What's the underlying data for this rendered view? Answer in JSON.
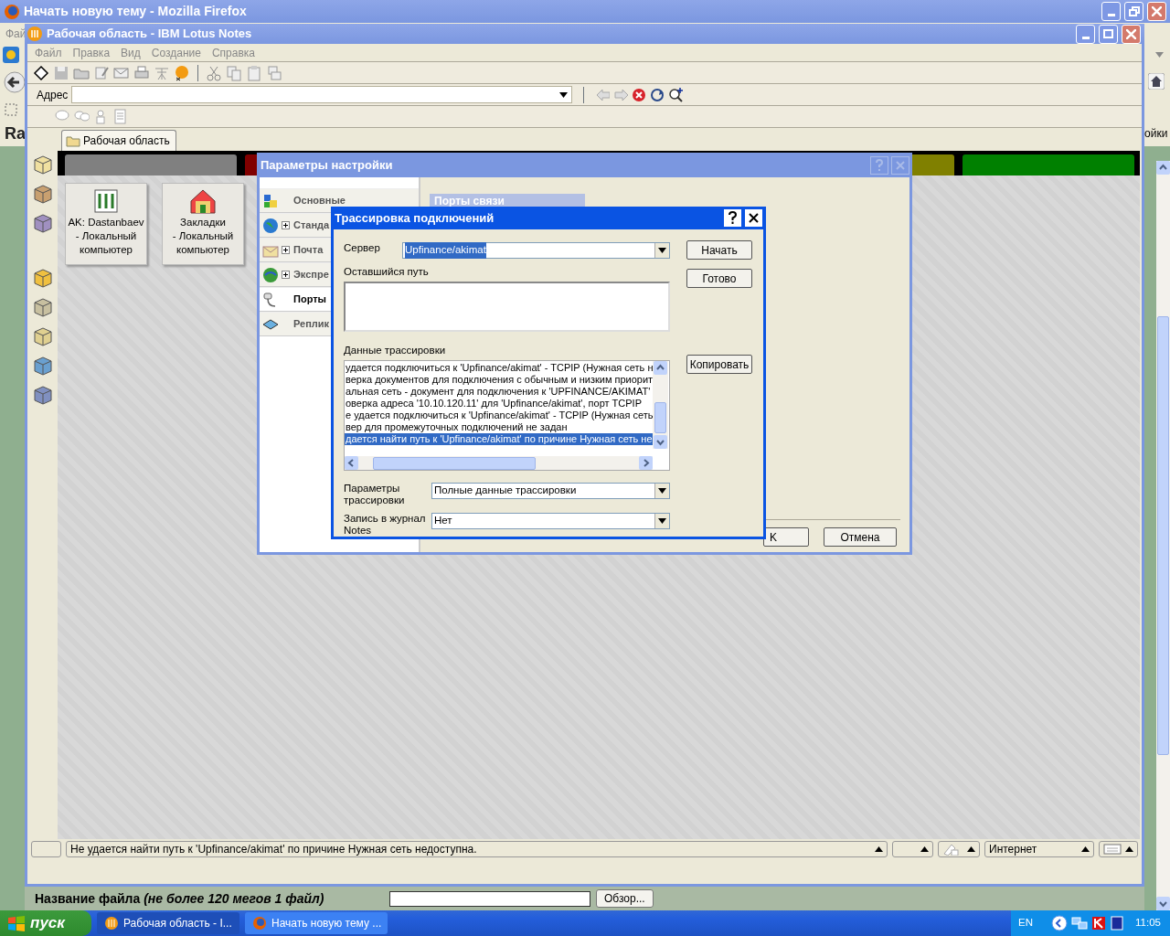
{
  "firefox": {
    "title": "Начать новую тему - Mozilla Firefox",
    "menu_fragment": "Фай",
    "page_fragment_left": "Ra",
    "page_fragment_right": "ойки",
    "file_label": "Название файла *(не более 120 мегов 1 файл)*",
    "browse_button": "Обзор..."
  },
  "notes": {
    "title": "Рабочая область - IBM Lotus Notes",
    "menu": [
      "Файл",
      "Правка",
      "Вид",
      "Создание",
      "Справка"
    ],
    "address_label": "Адрес",
    "tab_label": "Рабочая область",
    "workspace_tabs": [
      {
        "color": "#808080"
      },
      {
        "color": "#800000"
      },
      {
        "color": "#808000"
      },
      {
        "color": "#008000"
      }
    ],
    "tiles": [
      {
        "title": "AK: Dastanbaev",
        "subtitle": "- Локальный компьютер"
      },
      {
        "title": "Закладки",
        "subtitle": "- Локальный компьютер"
      }
    ],
    "status_message": "Не удается найти путь к 'Upfinance/akimat' по причине Нужная сеть недоступна.",
    "status_zone": "Интернет"
  },
  "settings_dialog": {
    "title": "Параметры настройки",
    "nav": [
      {
        "label": "Основные",
        "expandable": false,
        "selected": false
      },
      {
        "label": "Станда",
        "expandable": true,
        "selected": false
      },
      {
        "label": "Почта",
        "expandable": true,
        "selected": false
      },
      {
        "label": "Экспре",
        "expandable": true,
        "selected": false
      },
      {
        "label": "Порты",
        "expandable": false,
        "selected": true
      },
      {
        "label": "Реплик",
        "expandable": false,
        "selected": false
      }
    ],
    "section_title": "Порты связи",
    "ok_button": "K",
    "cancel_button": "Отмена"
  },
  "trace_dialog": {
    "title": "Трассировка подключений",
    "server_label": "Сервер",
    "server_value": "Upfinance/akimat",
    "remaining_path_label": "Оставшийся путь",
    "trace_label": "Данные трассировки",
    "trace_lines": [
      {
        "text": "удается подключиться к 'Upfinance/akimat' - TCPIP (Нужная сеть н",
        "selected": false
      },
      {
        "text": "верка документов для подключения с обычным и низким приорит",
        "selected": false
      },
      {
        "text": "альная сеть  - документ для подключения к 'UPFINANCE/AKIMAT'",
        "selected": false
      },
      {
        "text": "оверка адреса '10.10.120.11' для 'Upfinance/akimat', порт TCPIP",
        "selected": false
      },
      {
        "text": "е удается подключиться к 'Upfinance/akimat' - TCPIP (Нужная сеть",
        "selected": false
      },
      {
        "text": "вер для промежуточных подключений не задан",
        "selected": false
      },
      {
        "text": "дается найти путь к 'Upfinance/akimat' по причине Нужная сеть не",
        "selected": true
      }
    ],
    "params_label": "Параметры трассировки",
    "params_value": "Полные данные трассировки",
    "log_label": "Запись в журнал Notes",
    "log_value": "Нет",
    "start_button": "Начать",
    "done_button": "Готово",
    "copy_button": "Копировать"
  },
  "taskbar": {
    "start": "пуск",
    "tasks": [
      {
        "label": "Рабочая область - I...",
        "selected": true
      },
      {
        "label": "Начать новую тему ...",
        "selected": false
      }
    ],
    "language": "EN",
    "clock": "11:05"
  }
}
